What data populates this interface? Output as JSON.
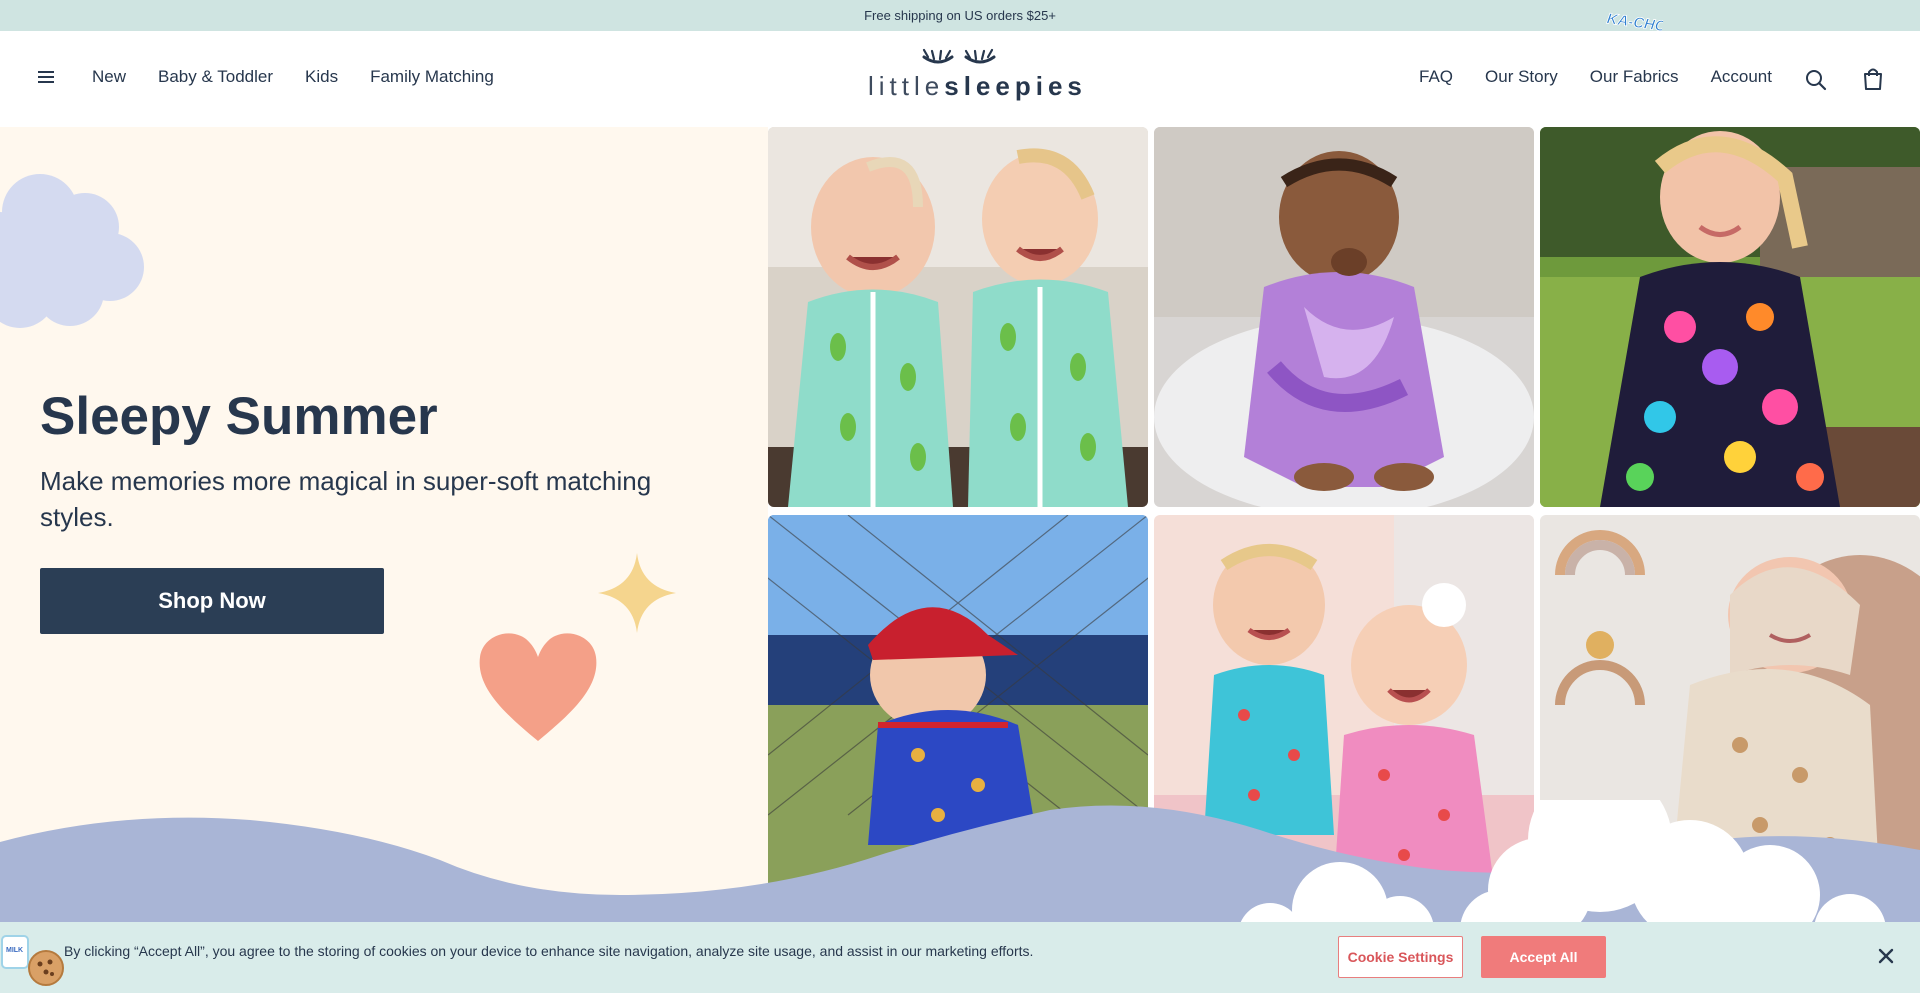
{
  "announcement": {
    "text": "Free shipping on US orders $25+",
    "badge_text": "KA-CHOW!"
  },
  "header": {
    "logo_light": "little",
    "logo_bold": "sleepies",
    "nav_left": [
      "New",
      "Baby & Toddler",
      "Kids",
      "Family Matching"
    ],
    "nav_right": [
      "FAQ",
      "Our Story",
      "Our Fabrics",
      "Account"
    ],
    "icons": [
      "menu-icon",
      "search-icon",
      "cart-icon"
    ]
  },
  "hero": {
    "title": "Sleepy Summer",
    "subtitle": "Make memories more magical in super-soft matching styles.",
    "cta_label": "Shop Now"
  },
  "colors": {
    "announce_bg": "#cfe4e1",
    "hero_bg": "#fff8ee",
    "navy": "#2b3e55",
    "wave": "#a9b5d6",
    "heart": "#f4a088",
    "sparkle": "#f5d58e",
    "cookie_bg": "#d9ecea",
    "accept": "#f07b7b"
  },
  "photos": [
    {
      "name": "photo-pickle-pajama-babies",
      "palette": "mint"
    },
    {
      "name": "photo-purple-tie-dye-baby",
      "palette": "purple"
    },
    {
      "name": "photo-floral-dress-toddler",
      "palette": "floral"
    },
    {
      "name": "photo-baseball-cap-toddler",
      "palette": "blue"
    },
    {
      "name": "photo-siblings-pajamas",
      "palette": "pink"
    },
    {
      "name": "photo-newborn-swaddle",
      "palette": "cream"
    }
  ],
  "cookie_banner": {
    "text": "By clicking “Accept All”, you agree to the storing of cookies on your device to enhance site navigation, analyze site usage, and assist in our marketing efforts.",
    "settings_label": "Cookie Settings",
    "accept_label": "Accept All"
  }
}
